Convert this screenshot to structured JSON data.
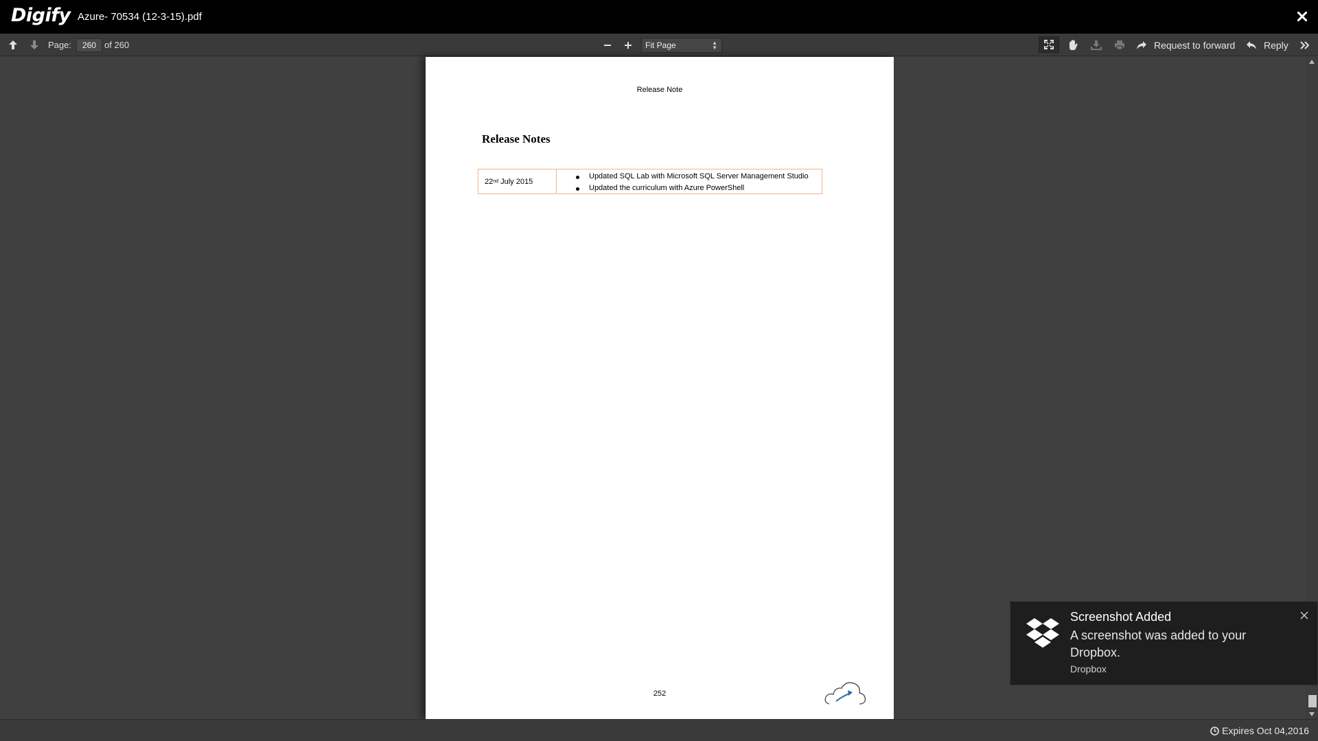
{
  "app": {
    "logo_text": "Digify",
    "document_title": "Azure- 70534 (12-3-15).pdf"
  },
  "toolbar": {
    "page_label": "Page:",
    "current_page": "260",
    "page_total_text": "of 260",
    "zoom_value": "Fit Page",
    "request_forward_label": "Request to forward",
    "reply_label": "Reply"
  },
  "pdf_page": {
    "header": "Release Note",
    "heading": "Release Notes",
    "table": {
      "date_main": "22",
      "date_sup": "nd",
      "date_rest": " July 2015",
      "items": [
        "Updated SQL Lab with Microsoft SQL Server Management Studio",
        "Updated the curriculum with Azure PowerShell"
      ]
    },
    "page_number": "252"
  },
  "status": {
    "expires_text": "Expires Oct 04,2016"
  },
  "toast": {
    "title": "Screenshot Added",
    "body": "A screenshot was added to your Dropbox.",
    "source": "Dropbox"
  },
  "icons": {
    "prev_page": "arrow-up-icon",
    "next_page": "arrow-down-icon",
    "zoom_out": "minus-icon",
    "zoom_in": "plus-icon",
    "fullscreen": "fullscreen-icon",
    "hand": "hand-icon",
    "download": "download-icon",
    "print": "print-icon",
    "forward": "forward-arrow-icon",
    "reply": "reply-arrow-icon",
    "more": "double-chevron-right-icon",
    "close": "close-icon",
    "clock": "clock-icon",
    "dropbox": "dropbox-icon"
  }
}
